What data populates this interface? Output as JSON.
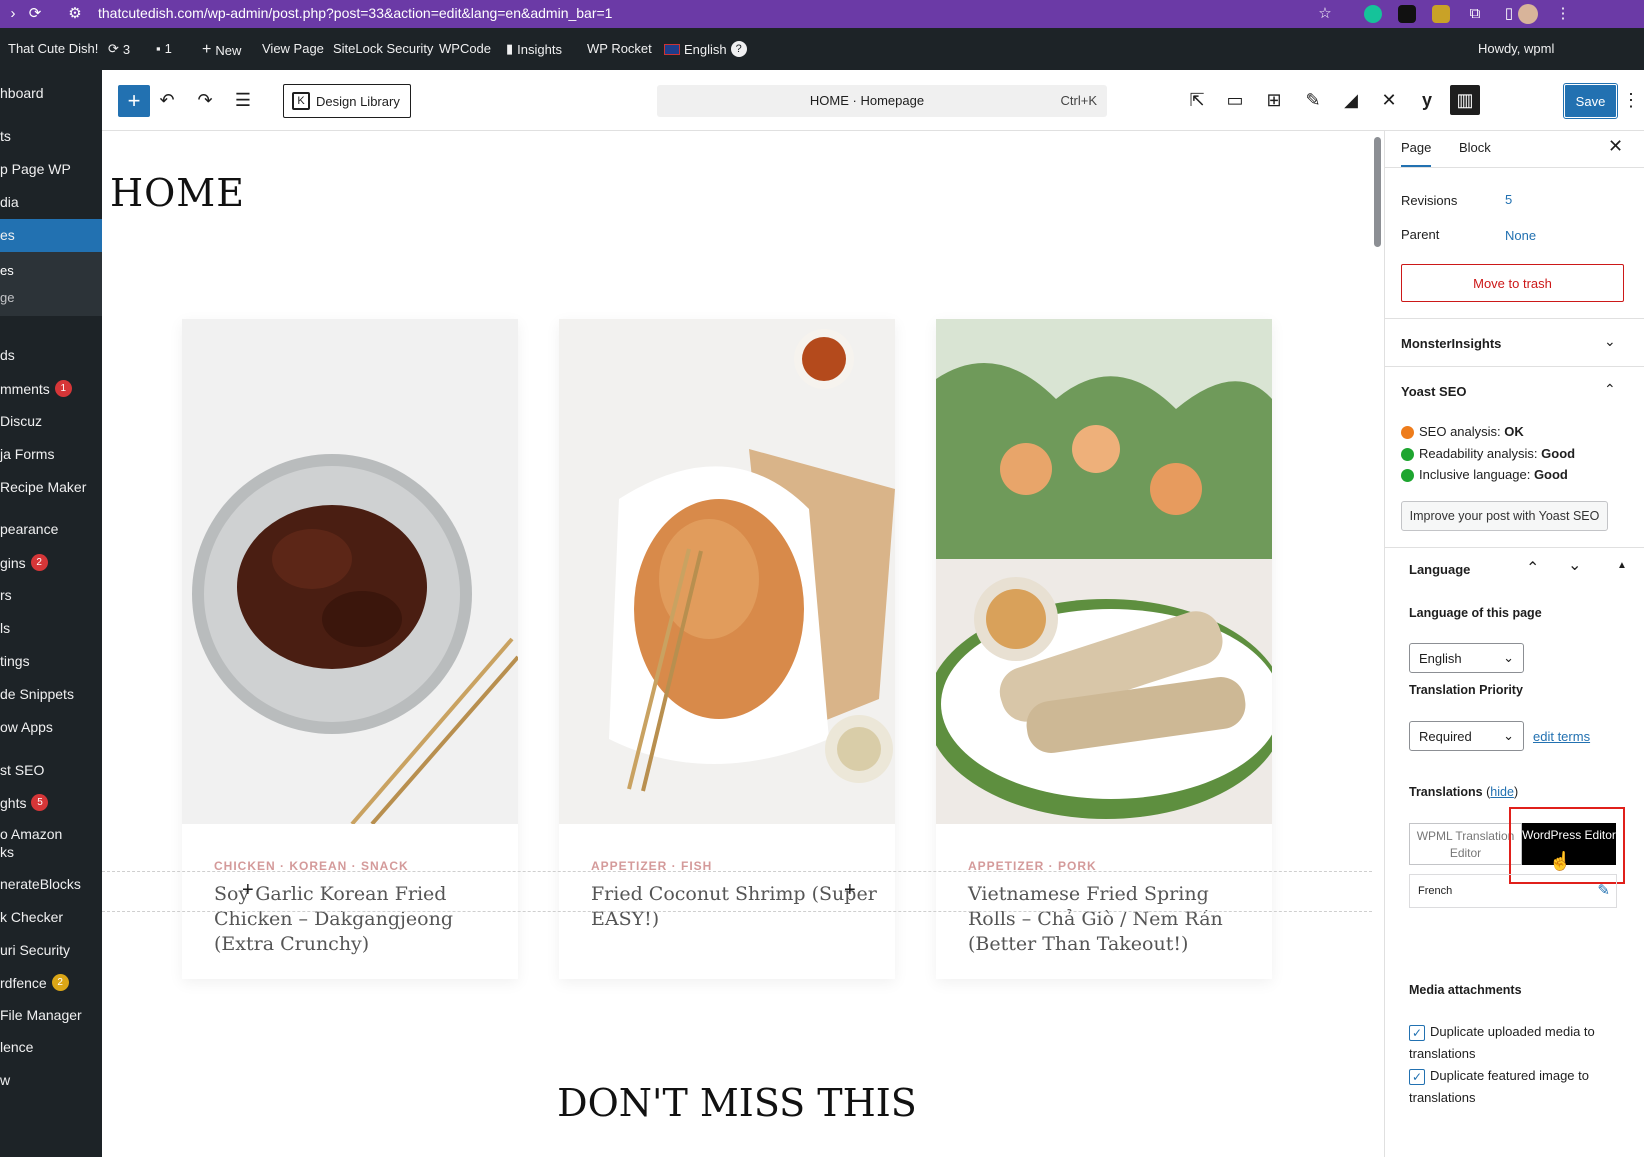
{
  "browser": {
    "url": "thatcutedish.com/wp-admin/post.php?post=33&action=edit&lang=en&admin_bar=1"
  },
  "adminbar": {
    "site_name": "That Cute Dish!",
    "updates_count": "3",
    "comments_count": "1",
    "new_label": "New",
    "view_page": "View Page",
    "sitelock": "SiteLock Security",
    "wpcode": "WPCode",
    "insights": "Insights",
    "wp_rocket": "WP Rocket",
    "language": "English",
    "help": "?",
    "howdy": "Howdy, wpml"
  },
  "sidebar": {
    "items": [
      {
        "label": "hboard"
      },
      {
        "label": "ts"
      },
      {
        "label": "p Page WP"
      },
      {
        "label": "dia"
      },
      {
        "label": "es"
      },
      {
        "label": "es"
      },
      {
        "label": "ge"
      },
      {
        "label": "ds"
      },
      {
        "label": "mments",
        "badge": "1"
      },
      {
        "label": "Discuz"
      },
      {
        "label": "ja Forms"
      },
      {
        "label": " Recipe Maker"
      },
      {
        "label": "pearance"
      },
      {
        "label": "gins",
        "badge": "2"
      },
      {
        "label": "rs"
      },
      {
        "label": "ls"
      },
      {
        "label": "tings"
      },
      {
        "label": "de Snippets"
      },
      {
        "label": "ow Apps"
      },
      {
        "label": "st SEO"
      },
      {
        "label": "ghts",
        "badge": "5"
      },
      {
        "label": "o Amazon"
      },
      {
        "label": "ks"
      },
      {
        "label": "nerateBlocks"
      },
      {
        "label": "k Checker"
      },
      {
        "label": "uri Security"
      },
      {
        "label": "rdfence",
        "badge": "2"
      },
      {
        "label": " File Manager"
      },
      {
        "label": "lence"
      },
      {
        "label": "w"
      }
    ]
  },
  "editor": {
    "design_library": "Design Library",
    "doc_title": "HOME · Homepage",
    "shortcut": "Ctrl+K",
    "save": "Save"
  },
  "canvas": {
    "page_title": "HOME",
    "cards": [
      {
        "category": "CHICKEN · KOREAN · SNACK",
        "title": "Soy Garlic Korean Fried Chicken – Dakgangjeong (Extra Crunchy)"
      },
      {
        "category": "APPETIZER · FISH",
        "title": "Fried Coconut Shrimp (Super EASY!)"
      },
      {
        "category": "APPETIZER · PORK",
        "title": "Vietnamese Fried Spring Rolls – Chả Giò / Nem Rán (Better Than Takeout!)"
      }
    ],
    "section_title": "DON'T MISS THIS"
  },
  "panel": {
    "tab_page": "Page",
    "tab_block": "Block",
    "revisions_label": "Revisions",
    "revisions_value": "5",
    "parent_label": "Parent",
    "parent_value": "None",
    "trash": "Move to trash",
    "monsterinsights": "MonsterInsights",
    "yoast": "Yoast SEO",
    "seo_label": "SEO analysis:",
    "seo_value": "OK",
    "read_label": "Readability analysis:",
    "read_value": "Good",
    "incl_label": "Inclusive language:",
    "incl_value": "Good",
    "yoast_btn": "Improve your post with Yoast SEO",
    "language_heading": "Language",
    "lang_of_page": "Language of this page",
    "lang_selected": "English",
    "priority_label": "Translation Priority",
    "priority_selected": "Required",
    "edit_terms": "edit terms",
    "translations_label": "Translations",
    "hide": "hide",
    "wpml_editor": "WPML Translation Editor",
    "wp_editor": "WordPress Editor",
    "french": "French",
    "media_heading": "Media attachments",
    "dup_media": "Duplicate uploaded media to translations",
    "dup_featured": "Duplicate featured image to translations"
  },
  "colors": {
    "accent": "#2271b1",
    "admin_dark": "#1d2327",
    "browser": "#6b3aa6",
    "highlight": "#e0201b",
    "category": "#d49a9a"
  }
}
